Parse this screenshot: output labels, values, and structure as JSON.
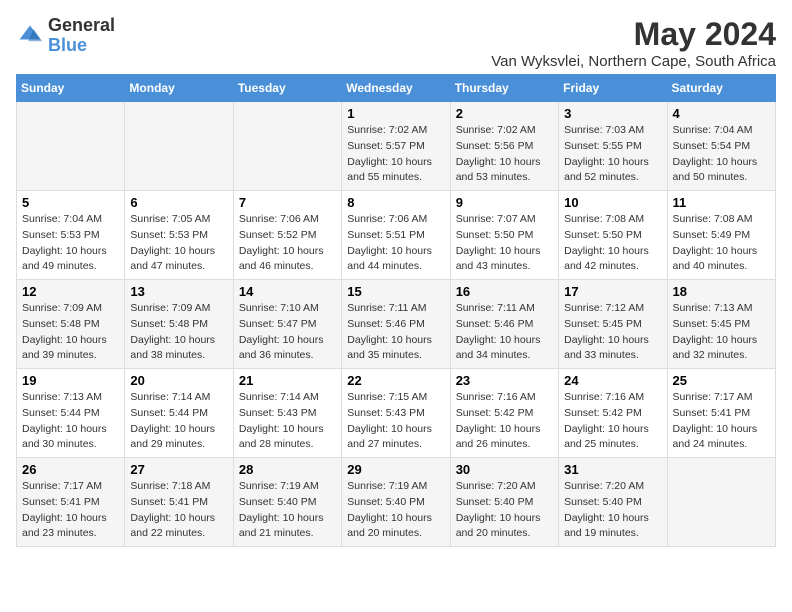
{
  "logo": {
    "general": "General",
    "blue": "Blue"
  },
  "title": "May 2024",
  "subtitle": "Van Wyksvlei, Northern Cape, South Africa",
  "days_of_week": [
    "Sunday",
    "Monday",
    "Tuesday",
    "Wednesday",
    "Thursday",
    "Friday",
    "Saturday"
  ],
  "weeks": [
    [
      {
        "day": "",
        "info": ""
      },
      {
        "day": "",
        "info": ""
      },
      {
        "day": "",
        "info": ""
      },
      {
        "day": "1",
        "info": "Sunrise: 7:02 AM\nSunset: 5:57 PM\nDaylight: 10 hours and 55 minutes."
      },
      {
        "day": "2",
        "info": "Sunrise: 7:02 AM\nSunset: 5:56 PM\nDaylight: 10 hours and 53 minutes."
      },
      {
        "day": "3",
        "info": "Sunrise: 7:03 AM\nSunset: 5:55 PM\nDaylight: 10 hours and 52 minutes."
      },
      {
        "day": "4",
        "info": "Sunrise: 7:04 AM\nSunset: 5:54 PM\nDaylight: 10 hours and 50 minutes."
      }
    ],
    [
      {
        "day": "5",
        "info": "Sunrise: 7:04 AM\nSunset: 5:53 PM\nDaylight: 10 hours and 49 minutes."
      },
      {
        "day": "6",
        "info": "Sunrise: 7:05 AM\nSunset: 5:53 PM\nDaylight: 10 hours and 47 minutes."
      },
      {
        "day": "7",
        "info": "Sunrise: 7:06 AM\nSunset: 5:52 PM\nDaylight: 10 hours and 46 minutes."
      },
      {
        "day": "8",
        "info": "Sunrise: 7:06 AM\nSunset: 5:51 PM\nDaylight: 10 hours and 44 minutes."
      },
      {
        "day": "9",
        "info": "Sunrise: 7:07 AM\nSunset: 5:50 PM\nDaylight: 10 hours and 43 minutes."
      },
      {
        "day": "10",
        "info": "Sunrise: 7:08 AM\nSunset: 5:50 PM\nDaylight: 10 hours and 42 minutes."
      },
      {
        "day": "11",
        "info": "Sunrise: 7:08 AM\nSunset: 5:49 PM\nDaylight: 10 hours and 40 minutes."
      }
    ],
    [
      {
        "day": "12",
        "info": "Sunrise: 7:09 AM\nSunset: 5:48 PM\nDaylight: 10 hours and 39 minutes."
      },
      {
        "day": "13",
        "info": "Sunrise: 7:09 AM\nSunset: 5:48 PM\nDaylight: 10 hours and 38 minutes."
      },
      {
        "day": "14",
        "info": "Sunrise: 7:10 AM\nSunset: 5:47 PM\nDaylight: 10 hours and 36 minutes."
      },
      {
        "day": "15",
        "info": "Sunrise: 7:11 AM\nSunset: 5:46 PM\nDaylight: 10 hours and 35 minutes."
      },
      {
        "day": "16",
        "info": "Sunrise: 7:11 AM\nSunset: 5:46 PM\nDaylight: 10 hours and 34 minutes."
      },
      {
        "day": "17",
        "info": "Sunrise: 7:12 AM\nSunset: 5:45 PM\nDaylight: 10 hours and 33 minutes."
      },
      {
        "day": "18",
        "info": "Sunrise: 7:13 AM\nSunset: 5:45 PM\nDaylight: 10 hours and 32 minutes."
      }
    ],
    [
      {
        "day": "19",
        "info": "Sunrise: 7:13 AM\nSunset: 5:44 PM\nDaylight: 10 hours and 30 minutes."
      },
      {
        "day": "20",
        "info": "Sunrise: 7:14 AM\nSunset: 5:44 PM\nDaylight: 10 hours and 29 minutes."
      },
      {
        "day": "21",
        "info": "Sunrise: 7:14 AM\nSunset: 5:43 PM\nDaylight: 10 hours and 28 minutes."
      },
      {
        "day": "22",
        "info": "Sunrise: 7:15 AM\nSunset: 5:43 PM\nDaylight: 10 hours and 27 minutes."
      },
      {
        "day": "23",
        "info": "Sunrise: 7:16 AM\nSunset: 5:42 PM\nDaylight: 10 hours and 26 minutes."
      },
      {
        "day": "24",
        "info": "Sunrise: 7:16 AM\nSunset: 5:42 PM\nDaylight: 10 hours and 25 minutes."
      },
      {
        "day": "25",
        "info": "Sunrise: 7:17 AM\nSunset: 5:41 PM\nDaylight: 10 hours and 24 minutes."
      }
    ],
    [
      {
        "day": "26",
        "info": "Sunrise: 7:17 AM\nSunset: 5:41 PM\nDaylight: 10 hours and 23 minutes."
      },
      {
        "day": "27",
        "info": "Sunrise: 7:18 AM\nSunset: 5:41 PM\nDaylight: 10 hours and 22 minutes."
      },
      {
        "day": "28",
        "info": "Sunrise: 7:19 AM\nSunset: 5:40 PM\nDaylight: 10 hours and 21 minutes."
      },
      {
        "day": "29",
        "info": "Sunrise: 7:19 AM\nSunset: 5:40 PM\nDaylight: 10 hours and 20 minutes."
      },
      {
        "day": "30",
        "info": "Sunrise: 7:20 AM\nSunset: 5:40 PM\nDaylight: 10 hours and 20 minutes."
      },
      {
        "day": "31",
        "info": "Sunrise: 7:20 AM\nSunset: 5:40 PM\nDaylight: 10 hours and 19 minutes."
      },
      {
        "day": "",
        "info": ""
      }
    ]
  ]
}
